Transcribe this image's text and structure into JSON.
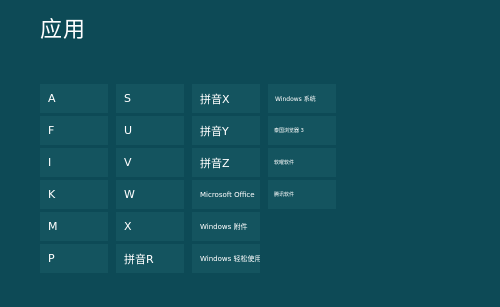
{
  "page": {
    "title": "应用"
  },
  "columns": [
    {
      "items": [
        "A",
        "F",
        "I",
        "K",
        "M",
        "P"
      ]
    },
    {
      "items": [
        "S",
        "U",
        "V",
        "W",
        "X",
        "拼音R"
      ]
    },
    {
      "items": [
        "拼音X",
        "拼音Y",
        "拼音Z",
        "Microsoft Office",
        "Windows 附件",
        "Windows 轻松使用"
      ]
    },
    {
      "items": [
        "Windows 系统",
        "泰国浏览器 3",
        "软曜软件",
        "腾讯软件"
      ]
    }
  ]
}
